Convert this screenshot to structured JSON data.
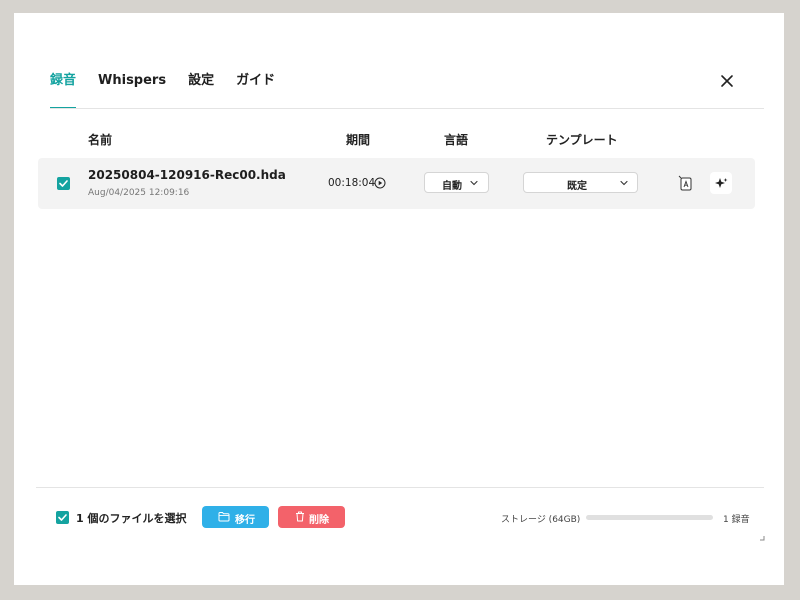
{
  "tabs": [
    {
      "label": "録音",
      "active": true
    },
    {
      "label": "Whispers",
      "active": false
    },
    {
      "label": "設定",
      "active": false
    },
    {
      "label": "ガイド",
      "active": false
    }
  ],
  "columns": {
    "name": "名前",
    "duration": "期間",
    "language": "言語",
    "template": "テンプレート"
  },
  "recordings": [
    {
      "checked": true,
      "file_name": "20250804-120916-Rec00.hda",
      "date": "Aug/04/2025  12:09:16",
      "duration": "00:18:04",
      "language": "自動",
      "template": "既定"
    }
  ],
  "footer": {
    "selection_text": "1 個のファイルを選択",
    "move_label": "移行",
    "delete_label": "削除",
    "storage_label": "ストレージ (64GB)",
    "storage_used_fraction": 0.0,
    "record_count": "1 録音"
  },
  "colors": {
    "accent": "#14a3a0",
    "move": "#2fb0e8",
    "delete": "#f3626a"
  },
  "icons": {
    "close": "close-icon",
    "play": "play-circle-icon",
    "transcribe": "document-a-icon",
    "summary": "sparkle-icon",
    "folder": "folder-icon",
    "trash": "trash-icon"
  }
}
